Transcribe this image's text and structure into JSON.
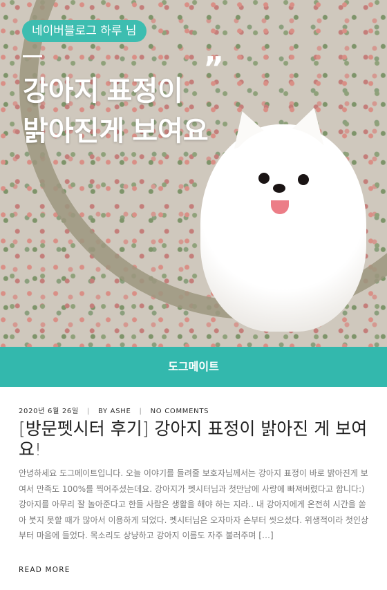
{
  "hero": {
    "badge": "네이버블로그 하루 님",
    "quote_mark": "”",
    "headline_line1": "강아지 표정이",
    "headline_line2": "밝아진게 보여요"
  },
  "band": {
    "label": "도그메이트"
  },
  "post": {
    "date": "2020년 6월 26일",
    "author": "BY ASHE",
    "comments": "NO COMMENTS",
    "separator": "|",
    "title": "[방문펫시터 후기] 강아지 표정이 밝아진 게 보여요!",
    "excerpt": "안녕하세요 도그메이트입니다. 오늘 이야기를 들려줄 보호자님께서는 강아지 표정이 바로 밝아진게 보여서 만족도 100%를 찍어주셨는데요. 강아지가 펫시터님과 첫만남에 사랑에 빠져버렸다고 합니다:) 강아지를 아무리 잘 놀아준다고 한들 사람은 생활을 해야 하는 지라.. 내 강아지에게 온전히 시간을 쏟아 붓지 못할 때가 많아서 이용하게 되었다. 펫시터님은 오자마자 손부터 씻으셨다. 위생적이라 첫인상부터 마음에 들었다. 목소리도 상냥하고 강아지 이름도 자주 불러주며 […]",
    "read_more": "READ MORE"
  },
  "colors": {
    "accent": "#33b8ad",
    "badge": "#3dbdb0"
  }
}
